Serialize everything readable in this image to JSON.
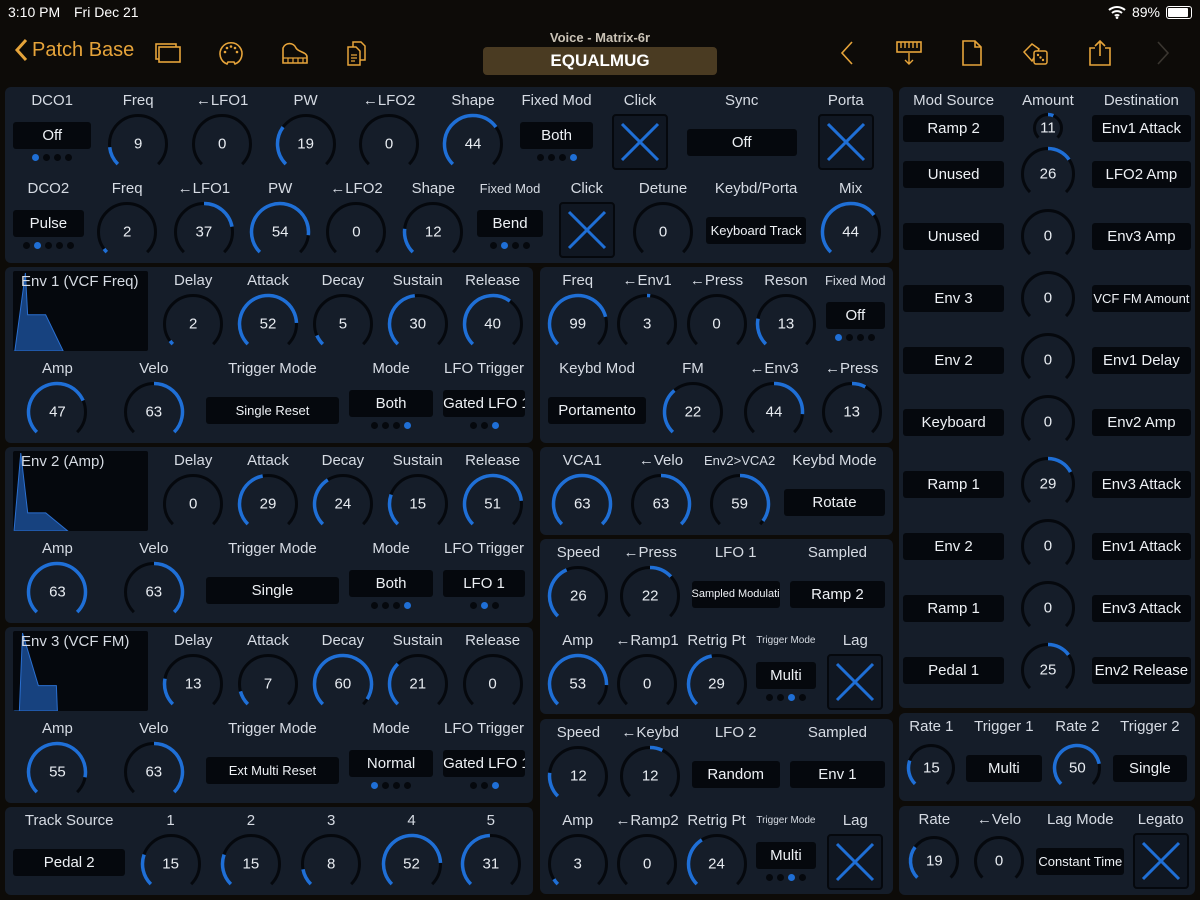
{
  "status": {
    "time": "3:10 PM",
    "date": "Fri Dec 21",
    "battery": "89%",
    "battery_level": 0.89
  },
  "nav": {
    "back_label": "Patch Base",
    "subtitle": "Voice - Matrix-6r",
    "title": "EQUALMUG",
    "left_icons": [
      "windows-icon",
      "midi-port-icon",
      "piano-icon",
      "documents-icon"
    ],
    "right_icons": [
      "chevron-left-icon",
      "keyboard-download-icon",
      "new-document-icon",
      "randomize-dice-icon",
      "share-icon",
      "chevron-right-icon"
    ]
  },
  "colors": {
    "accent": "#1f6fd6",
    "nav": "#e6a43a",
    "panel": "#151d29",
    "background": "#0d0b08"
  },
  "panels": {
    "dco": {
      "rows": [
        [
          {
            "label": "DCO1",
            "type": "select",
            "value": "Off",
            "dots": 4,
            "sel": 0
          },
          {
            "label": "Freq",
            "type": "knob",
            "value": 9,
            "max": 63
          },
          {
            "label": "←LFO1",
            "type": "knob",
            "value": 0,
            "max": 63,
            "bipolar": true
          },
          {
            "label": "PW",
            "type": "knob",
            "value": 19,
            "max": 63
          },
          {
            "label": "←LFO2",
            "type": "knob",
            "value": 0,
            "max": 63,
            "bipolar": true
          },
          {
            "label": "Shape",
            "type": "knob",
            "value": 44,
            "max": 63
          },
          {
            "label": "Fixed Mod",
            "type": "select",
            "value": "Both",
            "dots": 4,
            "sel": 3
          },
          {
            "label": "Click",
            "type": "check",
            "checked": true
          },
          {
            "label": "Sync",
            "type": "select",
            "value": "Off"
          },
          {
            "label": "Porta",
            "type": "check",
            "checked": true
          }
        ],
        [
          {
            "label": "DCO2",
            "type": "select",
            "value": "Pulse",
            "dots": 5,
            "sel": 1
          },
          {
            "label": "Freq",
            "type": "knob",
            "value": 2,
            "max": 63
          },
          {
            "label": "←LFO1",
            "type": "knob",
            "value": 37,
            "max": 63,
            "bipolar": true
          },
          {
            "label": "PW",
            "type": "knob",
            "value": 54,
            "max": 63
          },
          {
            "label": "←LFO2",
            "type": "knob",
            "value": 0,
            "max": 63,
            "bipolar": true
          },
          {
            "label": "Shape",
            "type": "knob",
            "value": 12,
            "max": 63
          },
          {
            "label": "Fixed Mod",
            "type": "select",
            "value": "Bend",
            "dots": 4,
            "sel": 1
          },
          {
            "label": "Click",
            "type": "check",
            "checked": true
          },
          {
            "label": "Detune",
            "type": "knob",
            "value": 0,
            "max": 31,
            "bipolar": true
          },
          {
            "label": "Keybd/Porta",
            "type": "select",
            "value": "Keyboard Track"
          },
          {
            "label": "Mix",
            "type": "knob",
            "value": 44,
            "max": 63
          }
        ]
      ]
    },
    "env1": {
      "rows": [
        [
          {
            "label": "Env 1 (VCF Freq)",
            "type": "graph"
          },
          {
            "label": "Delay",
            "type": "knob",
            "value": 2,
            "max": 63
          },
          {
            "label": "Attack",
            "type": "knob",
            "value": 52,
            "max": 63
          },
          {
            "label": "Decay",
            "type": "knob",
            "value": 5,
            "max": 63
          },
          {
            "label": "Sustain",
            "type": "knob",
            "value": 30,
            "max": 63
          },
          {
            "label": "Release",
            "type": "knob",
            "value": 40,
            "max": 63
          }
        ],
        [
          {
            "label": "Amp",
            "type": "knob",
            "value": 47,
            "max": 63
          },
          {
            "label": "Velo",
            "type": "knob",
            "value": 63,
            "max": 63,
            "bipolar": true
          },
          {
            "label": "Trigger Mode",
            "type": "select",
            "value": "Single Reset"
          },
          {
            "label": "Mode",
            "type": "select",
            "value": "Both",
            "dots": 4,
            "sel": 3
          },
          {
            "label": "LFO Trigger",
            "type": "select",
            "value": "Gated LFO 1",
            "dots": 3,
            "sel": 2
          }
        ]
      ]
    },
    "env2": {
      "rows": [
        [
          {
            "label": "Env 2 (Amp)",
            "type": "graph"
          },
          {
            "label": "Delay",
            "type": "knob",
            "value": 0,
            "max": 63
          },
          {
            "label": "Attack",
            "type": "knob",
            "value": 29,
            "max": 63
          },
          {
            "label": "Decay",
            "type": "knob",
            "value": 24,
            "max": 63
          },
          {
            "label": "Sustain",
            "type": "knob",
            "value": 15,
            "max": 63
          },
          {
            "label": "Release",
            "type": "knob",
            "value": 51,
            "max": 63
          }
        ],
        [
          {
            "label": "Amp",
            "type": "knob",
            "value": 63,
            "max": 63
          },
          {
            "label": "Velo",
            "type": "knob",
            "value": 63,
            "max": 63,
            "bipolar": true
          },
          {
            "label": "Trigger Mode",
            "type": "select",
            "value": "Single"
          },
          {
            "label": "Mode",
            "type": "select",
            "value": "Both",
            "dots": 4,
            "sel": 3
          },
          {
            "label": "LFO Trigger",
            "type": "select",
            "value": "LFO 1",
            "dots": 3,
            "sel": 1
          }
        ]
      ]
    },
    "env3": {
      "rows": [
        [
          {
            "label": "Env 3 (VCF FM)",
            "type": "graph"
          },
          {
            "label": "Delay",
            "type": "knob",
            "value": 13,
            "max": 63
          },
          {
            "label": "Attack",
            "type": "knob",
            "value": 7,
            "max": 63
          },
          {
            "label": "Decay",
            "type": "knob",
            "value": 60,
            "max": 63
          },
          {
            "label": "Sustain",
            "type": "knob",
            "value": 21,
            "max": 63
          },
          {
            "label": "Release",
            "type": "knob",
            "value": 0,
            "max": 63
          }
        ],
        [
          {
            "label": "Amp",
            "type": "knob",
            "value": 55,
            "max": 63
          },
          {
            "label": "Velo",
            "type": "knob",
            "value": 63,
            "max": 63,
            "bipolar": true
          },
          {
            "label": "Trigger Mode",
            "type": "select",
            "value": "Ext Multi Reset"
          },
          {
            "label": "Mode",
            "type": "select",
            "value": "Normal",
            "dots": 4,
            "sel": 0
          },
          {
            "label": "LFO Trigger",
            "type": "select",
            "value": "Gated LFO 1",
            "dots": 3,
            "sel": 2
          }
        ]
      ]
    },
    "track": {
      "rows": [
        [
          {
            "label": "Track Source",
            "type": "select",
            "value": "Pedal 2"
          },
          {
            "label": "1",
            "type": "knob",
            "value": 15,
            "max": 63
          },
          {
            "label": "2",
            "type": "knob",
            "value": 15,
            "max": 63
          },
          {
            "label": "3",
            "type": "knob",
            "value": 8,
            "max": 63
          },
          {
            "label": "4",
            "type": "knob",
            "value": 52,
            "max": 63
          },
          {
            "label": "5",
            "type": "knob",
            "value": 31,
            "max": 63
          }
        ]
      ]
    },
    "filter": {
      "rows": [
        [
          {
            "label": "Freq",
            "type": "knob",
            "value": 99,
            "max": 127
          },
          {
            "label": "←Env1",
            "type": "knob",
            "value": 3,
            "max": 63,
            "bipolar": true
          },
          {
            "label": "←Press",
            "type": "knob",
            "value": 0,
            "max": 63,
            "bipolar": true
          },
          {
            "label": "Reson",
            "type": "knob",
            "value": 13,
            "max": 63
          },
          {
            "label": "Fixed Mod",
            "type": "select",
            "value": "Off",
            "dots": 4,
            "sel": 0
          }
        ],
        [
          {
            "label": "Keybd Mod",
            "type": "select",
            "value": "Portamento"
          },
          {
            "label": "FM",
            "type": "knob",
            "value": 22,
            "max": 63
          },
          {
            "label": "←Env3",
            "type": "knob",
            "value": 44,
            "max": 63,
            "bipolar": true
          },
          {
            "label": "←Press",
            "type": "knob",
            "value": 13,
            "max": 63,
            "bipolar": true
          }
        ]
      ]
    },
    "vca": {
      "rows": [
        [
          {
            "label": "VCA1",
            "type": "knob",
            "value": 63,
            "max": 63
          },
          {
            "label": "←Velo",
            "type": "knob",
            "value": 63,
            "max": 63,
            "bipolar": true
          },
          {
            "label": "Env2>VCA2",
            "type": "knob",
            "value": 59,
            "max": 63,
            "bipolar": true
          },
          {
            "label": "Keybd Mode",
            "type": "select",
            "value": "Rotate"
          }
        ]
      ]
    },
    "lfo1": {
      "rows": [
        [
          {
            "label": "Speed",
            "type": "knob",
            "value": 26,
            "max": 63
          },
          {
            "label": "←Press",
            "type": "knob",
            "value": 22,
            "max": 63,
            "bipolar": true
          },
          {
            "label": "LFO 1",
            "type": "select",
            "value": "Sampled Modulation"
          },
          {
            "label": "Sampled",
            "type": "select",
            "value": "Ramp 2"
          }
        ],
        [
          {
            "label": "Amp",
            "type": "knob",
            "value": 53,
            "max": 63
          },
          {
            "label": "←Ramp1",
            "type": "knob",
            "value": 0,
            "max": 63,
            "bipolar": true
          },
          {
            "label": "Retrig Pt",
            "type": "knob",
            "value": 29,
            "max": 63
          },
          {
            "label": "Trigger Mode",
            "type": "select",
            "value": "Multi",
            "dots": 4,
            "sel": 2
          },
          {
            "label": "Lag",
            "type": "check",
            "checked": true
          }
        ]
      ]
    },
    "lfo2": {
      "rows": [
        [
          {
            "label": "Speed",
            "type": "knob",
            "value": 12,
            "max": 63
          },
          {
            "label": "←Keybd",
            "type": "knob",
            "value": 12,
            "max": 63,
            "bipolar": true
          },
          {
            "label": "LFO 2",
            "type": "select",
            "value": "Random"
          },
          {
            "label": "Sampled",
            "type": "select",
            "value": "Env 1"
          }
        ],
        [
          {
            "label": "Amp",
            "type": "knob",
            "value": 3,
            "max": 63
          },
          {
            "label": "←Ramp2",
            "type": "knob",
            "value": 0,
            "max": 63,
            "bipolar": true
          },
          {
            "label": "Retrig Pt",
            "type": "knob",
            "value": 24,
            "max": 63
          },
          {
            "label": "Trigger Mode",
            "type": "select",
            "value": "Multi",
            "dots": 4,
            "sel": 2
          },
          {
            "label": "Lag",
            "type": "check",
            "checked": true
          }
        ]
      ]
    },
    "ramp": {
      "rows": [
        [
          {
            "label": "Rate 1",
            "type": "knob",
            "value": 15,
            "max": 63
          },
          {
            "label": "Trigger 1",
            "type": "select",
            "value": "Multi"
          },
          {
            "label": "Rate 2",
            "type": "knob",
            "value": 50,
            "max": 63
          },
          {
            "label": "Trigger 2",
            "type": "select",
            "value": "Single"
          }
        ]
      ]
    },
    "porta": {
      "rows": [
        [
          {
            "label": "Rate",
            "type": "knob",
            "value": 19,
            "max": 63
          },
          {
            "label": "←Velo",
            "type": "knob",
            "value": 0,
            "max": 63,
            "bipolar": true
          },
          {
            "label": "Lag Mode",
            "type": "select",
            "value": "Constant Time"
          },
          {
            "label": "Legato",
            "type": "check",
            "checked": true
          }
        ]
      ]
    }
  },
  "mod_matrix": {
    "headers": [
      "Mod Source",
      "Amount",
      "Destination"
    ],
    "amount_max": 63,
    "rows": [
      {
        "source": "Ramp 2",
        "amount": 11,
        "destination": "Env1 Attack"
      },
      {
        "source": "Unused",
        "amount": 26,
        "destination": "LFO2 Amp"
      },
      {
        "source": "Unused",
        "amount": 0,
        "destination": "Env3 Amp"
      },
      {
        "source": "Env 3",
        "amount": 0,
        "destination": "VCF FM Amount"
      },
      {
        "source": "Env 2",
        "amount": 0,
        "destination": "Env1 Delay"
      },
      {
        "source": "Keyboard",
        "amount": 0,
        "destination": "Env2 Amp"
      },
      {
        "source": "Ramp 1",
        "amount": 29,
        "destination": "Env3 Attack"
      },
      {
        "source": "Env 2",
        "amount": 0,
        "destination": "Env1 Attack"
      },
      {
        "source": "Ramp 1",
        "amount": 0,
        "destination": "Env3 Attack"
      },
      {
        "source": "Pedal 1",
        "amount": 25,
        "destination": "Env2 Release"
      }
    ]
  }
}
